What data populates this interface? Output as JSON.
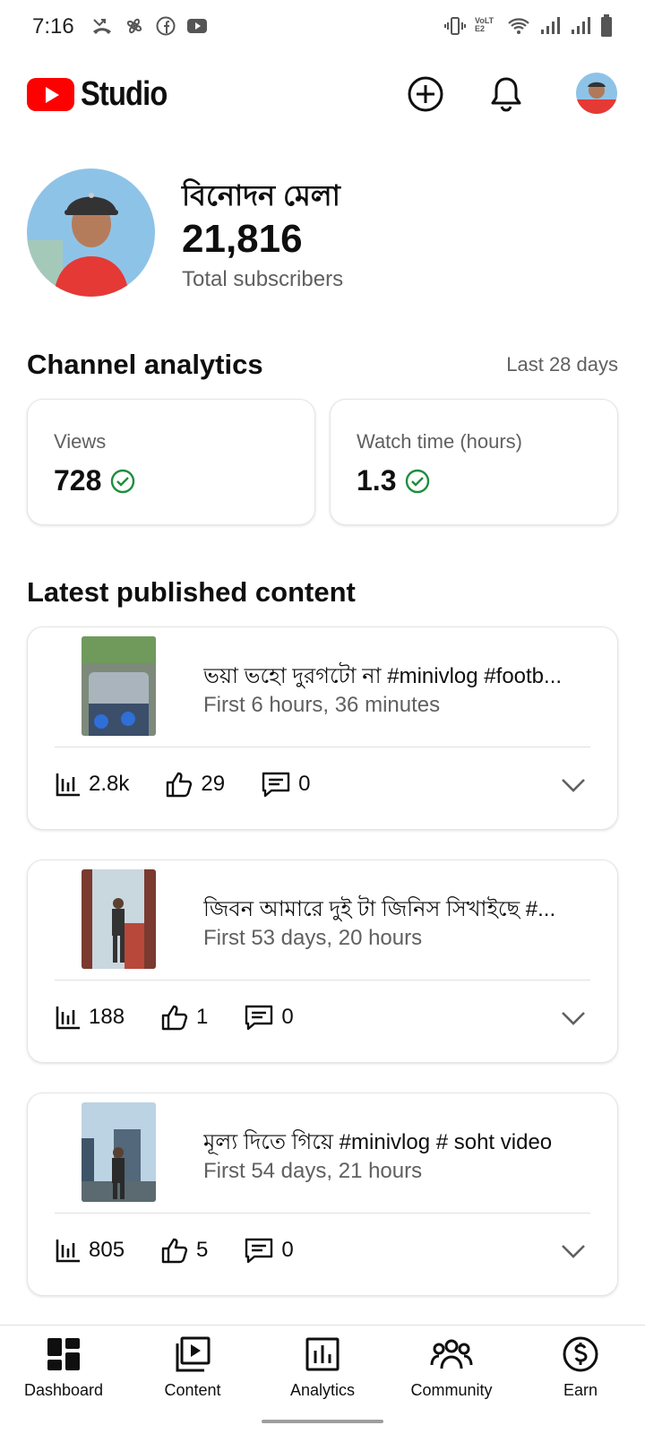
{
  "status_bar": {
    "time": "7:16",
    "left_icons": [
      "missed-call-icon",
      "pinwheel-icon",
      "facebook-icon",
      "youtube-icon"
    ],
    "right_icons": [
      "vibrate-icon",
      "volte-icon",
      "wifi-icon",
      "signal-icon",
      "signal-icon",
      "battery-icon"
    ],
    "volte_label": "VoLTE2"
  },
  "header": {
    "logo_text": "Studio",
    "brand_color": "#FF0000",
    "create_icon": "plus-circle-icon",
    "notifications_icon": "bell-icon",
    "account_icon": "avatar"
  },
  "channel": {
    "name": "বিনোদন মেলা",
    "subscribers": "21,816",
    "subscribers_label": "Total subscribers"
  },
  "analytics": {
    "title": "Channel analytics",
    "range": "Last 28 days",
    "metrics": [
      {
        "label": "Views",
        "value": "728",
        "status_icon": "check-circle-icon"
      },
      {
        "label": "Watch time (hours)",
        "value": "1.3",
        "status_icon": "check-circle-icon"
      }
    ],
    "status_color": "#1E8E3E"
  },
  "latest": {
    "title": "Latest published content",
    "items": [
      {
        "title": "ভয়া ভহো দুরগটো না #minivlog #footb...",
        "age": "First 6 hours, 36 minutes",
        "views": "2.8k",
        "likes": "29",
        "comments": "0"
      },
      {
        "title": "জিবন আমারে দুই টা জিনিস সিখাইছে #...",
        "age": "First 53 days, 20 hours",
        "views": "188",
        "likes": "1",
        "comments": "0"
      },
      {
        "title": "মূল্য দিতে গিয়ে #minivlog # soht video",
        "age": "First 54 days, 21 hours",
        "views": "805",
        "likes": "5",
        "comments": "0"
      }
    ]
  },
  "nav": {
    "items": [
      {
        "label": "Dashboard",
        "icon": "dashboard-icon"
      },
      {
        "label": "Content",
        "icon": "content-icon"
      },
      {
        "label": "Analytics",
        "icon": "analytics-icon"
      },
      {
        "label": "Community",
        "icon": "community-icon"
      },
      {
        "label": "Earn",
        "icon": "earn-icon"
      }
    ]
  }
}
